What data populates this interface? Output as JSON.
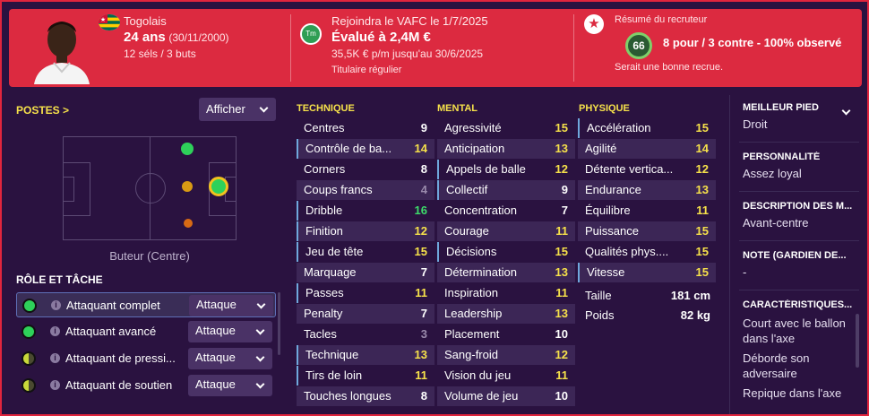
{
  "header": {
    "nationality": "Togolais",
    "age": "24 ans",
    "dob": "(30/11/2000)",
    "caps": "12 séls / 3 buts",
    "transfer": "Rejoindra le VAFC le 1/7/2025",
    "club_logo": "Tm",
    "value": "Évalué à 2,4M €",
    "contract": "35,5K € p/m jusqu'au 30/6/2025",
    "status": "Titulaire régulier",
    "scout_title": "Résumé du recruteur",
    "scout_rating": "66",
    "scout_summary": "8 pour / 3 contre - 100% observé",
    "scout_note": "Serait une bonne recrue."
  },
  "positions": {
    "heading": "POSTES >",
    "show_label": "Afficher",
    "position_name": "Buteur (Centre)"
  },
  "roles": {
    "heading": "RÔLE ET TÂCHE",
    "items": [
      {
        "label": "Attaquant complet",
        "duty": "Attaque",
        "color": "#2ed15a"
      },
      {
        "label": "Attaquant avancé",
        "duty": "Attaque",
        "color": "#2ed15a"
      },
      {
        "label": "Attaquant de pressi...",
        "duty": "Attaque",
        "color": "#c9d93a"
      },
      {
        "label": "Attaquant de soutien",
        "duty": "Attaque",
        "color": "#c9d93a"
      }
    ]
  },
  "technique": {
    "heading": "TECHNIQUE",
    "items": [
      {
        "name": "Centres",
        "value": "9"
      },
      {
        "name": "Contrôle de ba...",
        "value": "14"
      },
      {
        "name": "Corners",
        "value": "8"
      },
      {
        "name": "Coups francs",
        "value": "4"
      },
      {
        "name": "Dribble",
        "value": "16"
      },
      {
        "name": "Finition",
        "value": "12"
      },
      {
        "name": "Jeu de tête",
        "value": "15"
      },
      {
        "name": "Marquage",
        "value": "7"
      },
      {
        "name": "Passes",
        "value": "11"
      },
      {
        "name": "Penalty",
        "value": "7"
      },
      {
        "name": "Tacles",
        "value": "3"
      },
      {
        "name": "Technique",
        "value": "13"
      },
      {
        "name": "Tirs de loin",
        "value": "11"
      },
      {
        "name": "Touches longues",
        "value": "8"
      }
    ]
  },
  "mental": {
    "heading": "MENTAL",
    "items": [
      {
        "name": "Agressivité",
        "value": "15"
      },
      {
        "name": "Anticipation",
        "value": "13"
      },
      {
        "name": "Appels de balle",
        "value": "12"
      },
      {
        "name": "Collectif",
        "value": "9"
      },
      {
        "name": "Concentration",
        "value": "7"
      },
      {
        "name": "Courage",
        "value": "11"
      },
      {
        "name": "Décisions",
        "value": "15"
      },
      {
        "name": "Détermination",
        "value": "13"
      },
      {
        "name": "Inspiration",
        "value": "11"
      },
      {
        "name": "Leadership",
        "value": "13"
      },
      {
        "name": "Placement",
        "value": "10"
      },
      {
        "name": "Sang-froid",
        "value": "12"
      },
      {
        "name": "Vision du jeu",
        "value": "11"
      },
      {
        "name": "Volume de jeu",
        "value": "10"
      }
    ]
  },
  "physique": {
    "heading": "PHYSIQUE",
    "items": [
      {
        "name": "Accélération",
        "value": "15"
      },
      {
        "name": "Agilité",
        "value": "14"
      },
      {
        "name": "Détente vertica...",
        "value": "12"
      },
      {
        "name": "Endurance",
        "value": "13"
      },
      {
        "name": "Équilibre",
        "value": "11"
      },
      {
        "name": "Puissance",
        "value": "15"
      },
      {
        "name": "Qualités phys....",
        "value": "15"
      },
      {
        "name": "Vitesse",
        "value": "15"
      }
    ],
    "height_label": "Taille",
    "height_value": "181 cm",
    "weight_label": "Poids",
    "weight_value": "82 kg"
  },
  "profile": {
    "best_foot_label": "MEILLEUR PIED",
    "best_foot_value": "Droit",
    "personality_label": "PERSONNALITÉ",
    "personality_value": "Assez loyal",
    "media_label": "DESCRIPTION DES M...",
    "media_value": "Avant-centre",
    "gk_label": "NOTE (GARDIEN DE...",
    "gk_value": "-",
    "traits_label": "CARACTÉRISTIQUES...",
    "traits": [
      "Court avec le ballon dans l'axe",
      "Déborde son adversaire",
      "Repique dans l'axe"
    ]
  },
  "colors": {
    "header_bg": "#dc2a40",
    "page_bg": "#2a1240",
    "heading_yellow": "#f6e14a",
    "value_white": "#ffffff",
    "value_yellow": "#f6e14a",
    "value_green": "#3ddc6a",
    "value_grey": "#9a8aac"
  }
}
